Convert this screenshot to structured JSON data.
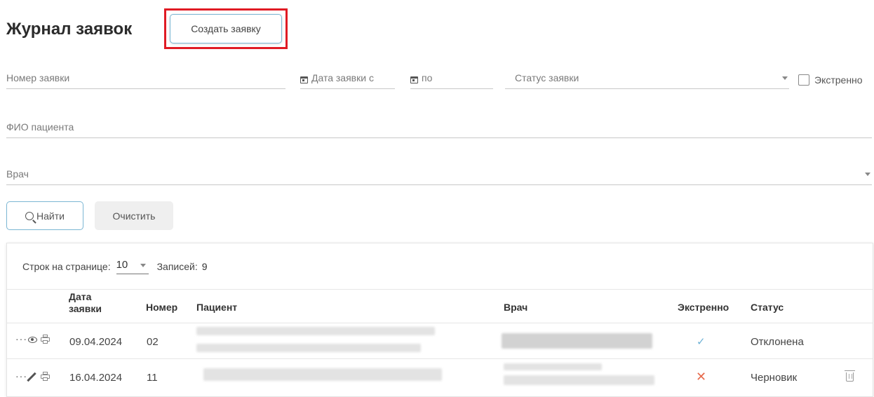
{
  "page": {
    "title": "Журнал заявок",
    "create_button": "Создать заявку"
  },
  "filters": {
    "request_number": "Номер заявки",
    "date_from": "Дата заявки с",
    "date_to": "по",
    "status": "Статус заявки",
    "urgent_label": "Экстренно",
    "patient_name": "ФИО пациента",
    "doctor": "Врач"
  },
  "actions": {
    "find": "Найти",
    "clear": "Очистить"
  },
  "table": {
    "rows_per_page_label": "Строк на странице:",
    "rows_per_page_value": "10",
    "records_label": "Записей:",
    "records_value": "9",
    "headers": {
      "date_line1": "Дата",
      "date_line2": "заявки",
      "number": "Номер",
      "patient": "Пациент",
      "doctor": "Врач",
      "urgent": "Экстренно",
      "status": "Статус"
    },
    "rows": [
      {
        "date": "09.04.2024",
        "number": "02",
        "urgent": "✓",
        "status": "Отклонена"
      },
      {
        "date": "16.04.2024",
        "number": "11",
        "urgent": "✕",
        "status": "Черновик"
      }
    ]
  },
  "icons": {
    "more": "···"
  },
  "colors": {
    "accent_border": "#7bb6d3",
    "highlight_red": "#e01b24",
    "check_blue": "#6fb2d6",
    "cross_red": "#e76b4d"
  }
}
